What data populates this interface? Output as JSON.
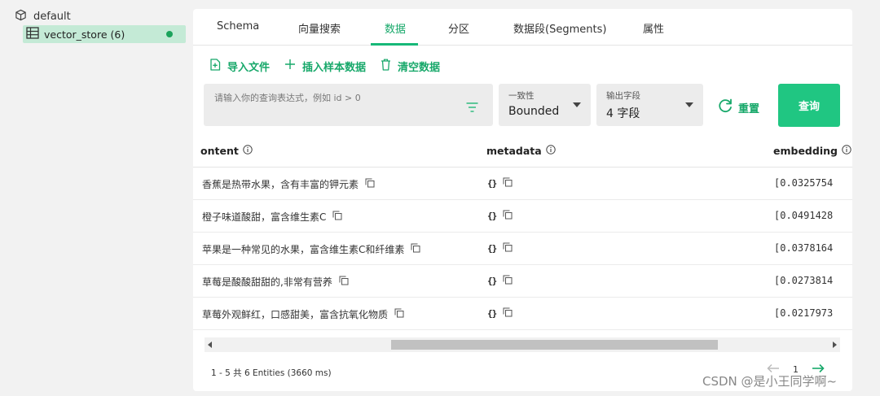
{
  "sidebar": {
    "database": "default",
    "collection": "vector_store (6)",
    "status_color": "#1ca35c"
  },
  "tabs": [
    "Schema",
    "向量搜索",
    "数据",
    "分区",
    "数据段(Segments)",
    "属性"
  ],
  "active_tab": "数据",
  "actions": {
    "import": "导入文件",
    "insert_sample": "插入样本数据",
    "clear": "清空数据"
  },
  "query": {
    "placeholder": "请输入你的查询表达式，例如 id > 0",
    "consistency_label": "一致性",
    "consistency_value": "Bounded",
    "output_fields_label": "输出字段",
    "output_fields_value": "4 字段",
    "reset_label": "重置",
    "query_button": "查询"
  },
  "table": {
    "columns": [
      "ontent",
      "metadata",
      "embedding"
    ],
    "rows": [
      {
        "content": "香蕉是热带水果，含有丰富的钾元素",
        "metadata": "{}",
        "embedding": "[0.0325754"
      },
      {
        "content": "橙子味道酸甜，富含维生素C",
        "metadata": "{}",
        "embedding": "[0.0491428"
      },
      {
        "content": "苹果是一种常见的水果，富含维生素C和纤维素",
        "metadata": "{}",
        "embedding": "[0.0378164"
      },
      {
        "content": "草莓是酸酸甜甜的,非常有营养",
        "metadata": "{}",
        "embedding": "[0.0273814"
      },
      {
        "content": "草莓外观鲜红，口感甜美，富含抗氧化物质",
        "metadata": "{}",
        "embedding": "[0.0217973"
      }
    ]
  },
  "footer": {
    "count": "1 - 5  共 6 Entities (3660 ms)",
    "page": "1"
  },
  "watermark": "CSDN @是小王同学啊~",
  "colors": {
    "accent": "#17a86a",
    "button": "#20c682"
  }
}
